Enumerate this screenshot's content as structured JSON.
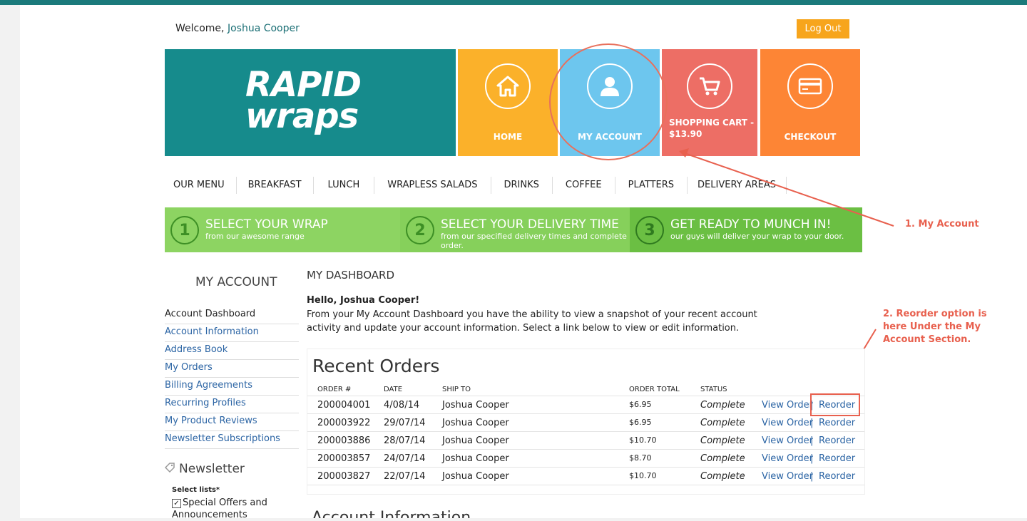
{
  "header": {
    "welcome_prefix": "Welcome,",
    "user_name": "Joshua Cooper",
    "logout_label": "Log Out"
  },
  "logo": {
    "line1": "RAPID",
    "line2": "wraps"
  },
  "tiles": {
    "home": "HOME",
    "account": "MY ACCOUNT",
    "cart_line1": "SHOPPING CART -",
    "cart_line2": "$13.90",
    "checkout": "CHECKOUT"
  },
  "menu": [
    "OUR MENU",
    "BREAKFAST",
    "LUNCH",
    "WRAPLESS SALADS",
    "DRINKS",
    "COFFEE",
    "PLATTERS",
    "DELIVERY AREAS"
  ],
  "steps": [
    {
      "num": "1",
      "title": "SELECT YOUR WRAP",
      "sub": "from our awesome range"
    },
    {
      "num": "2",
      "title": "SELECT YOUR DELIVERY TIME",
      "sub": "from our specified delivery times and complete order."
    },
    {
      "num": "3",
      "title": "GET READY TO MUNCH IN!",
      "sub": "our guys will deliver your wrap to your door."
    }
  ],
  "annotations": {
    "a1": "1. My Account",
    "a2": "2. Reorder option is here Under the My Account Section."
  },
  "sidebar": {
    "title": "MY ACCOUNT",
    "items": [
      "Account Dashboard",
      "Account Information",
      "Address Book",
      "My Orders",
      "Billing Agreements",
      "Recurring Profiles",
      "My Product Reviews",
      "Newsletter Subscriptions"
    ],
    "newsletter_title": "Newsletter",
    "select_lists": "Select lists*",
    "checkbox_label": "Special Offers and Announcements"
  },
  "dashboard": {
    "title": "MY DASHBOARD",
    "hello": "Hello, Joshua Cooper!",
    "intro": "From your My Account Dashboard you have the ability to view a snapshot of your recent account activity and update your account information. Select a link below to view or edit information."
  },
  "orders": {
    "title": "Recent Orders",
    "columns": [
      "ORDER #",
      "DATE",
      "SHIP TO",
      "ORDER TOTAL",
      "STATUS"
    ],
    "view_label": "View Order",
    "reorder_label": "Reorder",
    "separator": "|",
    "rows": [
      {
        "id": "200004001",
        "date": "4/08/14",
        "ship_to": "Joshua Cooper",
        "total": "$6.95",
        "status": "Complete"
      },
      {
        "id": "200003922",
        "date": "29/07/14",
        "ship_to": "Joshua Cooper",
        "total": "$6.95",
        "status": "Complete"
      },
      {
        "id": "200003886",
        "date": "28/07/14",
        "ship_to": "Joshua Cooper",
        "total": "$10.70",
        "status": "Complete"
      },
      {
        "id": "200003857",
        "date": "24/07/14",
        "ship_to": "Joshua Cooper",
        "total": "$8.70",
        "status": "Complete"
      },
      {
        "id": "200003827",
        "date": "22/07/14",
        "ship_to": "Joshua Cooper",
        "total": "$10.70",
        "status": "Complete"
      }
    ]
  },
  "account_info_title": "Account Information",
  "colors": {
    "teal": "#168b8c",
    "home": "#fbb12a",
    "account": "#6dc6ee",
    "cart": "#ed6e65",
    "checkout": "#fd8535",
    "annotation": "#e8604e",
    "link": "#2b64a4"
  }
}
